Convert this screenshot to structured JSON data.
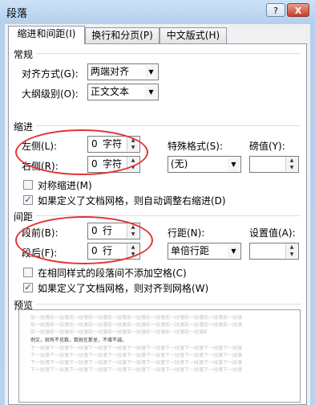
{
  "window": {
    "title": "段落",
    "help_glyph": "?",
    "close_glyph": "X"
  },
  "tabs": [
    {
      "label": "缩进和间距(I)",
      "active": true
    },
    {
      "label": "换行和分页(P)",
      "active": false
    },
    {
      "label": "中文版式(H)",
      "active": false
    }
  ],
  "general": {
    "heading": "常规",
    "alignment_label": "对齐方式(G):",
    "alignment_value": "两端对齐",
    "outline_label": "大纲级别(O):",
    "outline_value": "正文文本"
  },
  "indent": {
    "heading": "缩进",
    "left_label": "左侧(L):",
    "left_value": "0",
    "left_unit": "字符",
    "right_label": "右侧(R):",
    "right_value": "0",
    "right_unit": "字符",
    "special_label": "特殊格式(S):",
    "special_value": "(无)",
    "by_label": "磅值(Y):",
    "by_value": "",
    "mirror_label": "对称缩进(M)",
    "mirror_checked": false,
    "grid_adjust_label": "如果定义了文档网格，则自动调整右缩进(D)",
    "grid_adjust_checked": true
  },
  "spacing": {
    "heading": "间距",
    "before_label": "段前(B):",
    "before_value": "0",
    "before_unit": "行",
    "after_label": "段后(F):",
    "after_value": "0",
    "after_unit": "行",
    "line_label": "行距(N):",
    "line_value": "单倍行距",
    "at_label": "设置值(A):",
    "at_value": "",
    "no_space_label": "在相同样式的段落间不添加空格(C)",
    "no_space_checked": false,
    "snap_label": "如果定义了文档网格，则对齐到网格(W)",
    "snap_checked": true
  },
  "preview": {
    "heading": "预览",
    "prev_text": "前一段落前一段落前一段落前一段落前一段落前一段落前一段落前一段落前一段落前一段落前一段落",
    "current_text": "例文，就有不见数，数就在那里，不增不减。",
    "next_text": "下一段落下一段落下一段落下一段落下一段落下一段落下一段落下一段落下一段落下一段落下一段落"
  },
  "colors": {
    "highlight_circle": "#e23434",
    "title_bar": "#b9d3ee",
    "close_button": "#c4402a"
  },
  "icons": {
    "dropdown": "▼",
    "spin_up": "▲",
    "spin_down": "▼",
    "check": "✓"
  }
}
